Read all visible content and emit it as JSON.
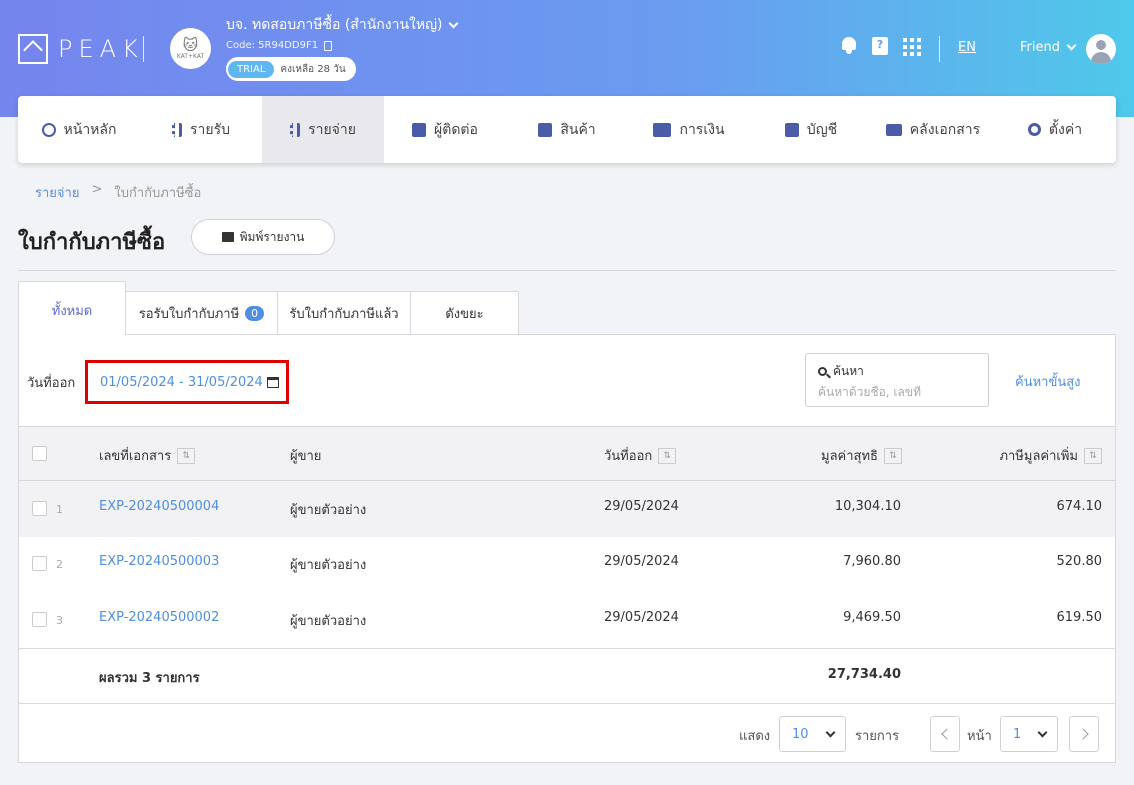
{
  "header": {
    "logo": "PEAK",
    "company_name": "บจ. ทดสอบภาษีซื้อ (สำนักงานใหญ่)",
    "company_code": "Code: 5R94DD9F1",
    "company_avatar_text": "KAT+KAT",
    "trial_badge": "TRIAL",
    "trial_remaining": "คงเหลือ 28 วัน",
    "help_glyph": "?",
    "language": "EN",
    "user_name": "Friend"
  },
  "nav": [
    {
      "label": "หน้าหลัก",
      "icon": "dashboard-icon"
    },
    {
      "label": "รายรับ",
      "icon": "income-icon"
    },
    {
      "label": "รายจ่าย",
      "icon": "expense-icon",
      "active": true
    },
    {
      "label": "ผู้ติดต่อ",
      "icon": "contacts-icon"
    },
    {
      "label": "สินค้า",
      "icon": "product-box-icon"
    },
    {
      "label": "การเงิน",
      "icon": "money-icon"
    },
    {
      "label": "บัญชี",
      "icon": "ledger-book-icon"
    },
    {
      "label": "คลังเอกสาร",
      "icon": "folder-icon"
    },
    {
      "label": "ตั้งค่า",
      "icon": "gear-icon"
    }
  ],
  "breadcrumb": {
    "parent": "รายจ่าย",
    "separator": ">",
    "current": "ใบกำกับภาษีซื้อ"
  },
  "page": {
    "title": "ใบกำกับภาษีซื้อ",
    "print_label": "พิมพ์รายงาน"
  },
  "tabs": {
    "all": "ทั้งหมด",
    "pending": "รอรับใบกำกับภาษี",
    "pending_count": "0",
    "received": "รับใบกำกับภาษีแล้ว",
    "draft": "ดังขยะ"
  },
  "filter": {
    "date_label": "วันที่ออก",
    "date_range": "01/05/2024 - 31/05/2024",
    "search_label": "ค้นหา",
    "search_placeholder": "ค้นหาด้วยชื่อ, เลขที่",
    "advanced_search": "ค้นหาขั้นสูง"
  },
  "table": {
    "columns": {
      "doc_no": "เลขที่เอกสาร",
      "seller": "ผู้ขาย",
      "date": "วันที่ออก",
      "net": "มูลค่าสุทธิ",
      "vat": "ภาษีมูลค่าเพิ่ม"
    },
    "rows": [
      {
        "num": "1",
        "doc_no": "EXP-20240500004",
        "seller": "ผู้ขายตัวอย่าง",
        "date": "29/05/2024",
        "net": "10,304.10",
        "vat": "674.10"
      },
      {
        "num": "2",
        "doc_no": "EXP-20240500003",
        "seller": "ผู้ขายตัวอย่าง",
        "date": "29/05/2024",
        "net": "7,960.80",
        "vat": "520.80"
      },
      {
        "num": "3",
        "doc_no": "EXP-20240500002",
        "seller": "ผู้ขายตัวอย่าง",
        "date": "29/05/2024",
        "net": "9,469.50",
        "vat": "619.50"
      }
    ],
    "total_label": "ผลรวม 3 รายการ",
    "total_net": "27,734.40"
  },
  "pagination": {
    "show_label": "แสดง",
    "page_size": "10",
    "items_label": "รายการ",
    "page_label": "หน้า",
    "page": "1"
  },
  "colors": {
    "accent": "#4e8fe3",
    "highlight_border": "#e00000",
    "header_start": "#7585ee",
    "header_end": "#4fc9ea"
  }
}
